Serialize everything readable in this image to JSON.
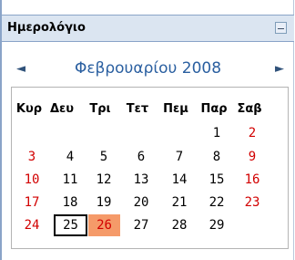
{
  "block": {
    "title": "Ημερολόγιο",
    "hide_icon": "minimize-icon"
  },
  "calendar": {
    "prev_icon": "arrow-left-icon",
    "next_icon": "arrow-right-icon",
    "month_title": "Φεβρουαρίου 2008",
    "weekdays": [
      "Κυρ",
      "Δευ",
      "Τρι",
      "Τετ",
      "Πεμ",
      "Παρ",
      "Σαβ"
    ],
    "weeks": [
      [
        "",
        "",
        "",
        "",
        "",
        "1",
        "2"
      ],
      [
        "3",
        "4",
        "5",
        "6",
        "7",
        "8",
        "9"
      ],
      [
        "10",
        "11",
        "12",
        "13",
        "14",
        "15",
        "16"
      ],
      [
        "17",
        "18",
        "19",
        "20",
        "21",
        "22",
        "23"
      ],
      [
        "24",
        "25",
        "26",
        "27",
        "28",
        "29",
        ""
      ]
    ],
    "today": "25",
    "highlighted_day": "26",
    "colors": {
      "weekend": "#d20000",
      "highlight": "#f59a69",
      "header_bg": "#dbe5f1",
      "month_title": "#2a5fa0"
    }
  }
}
